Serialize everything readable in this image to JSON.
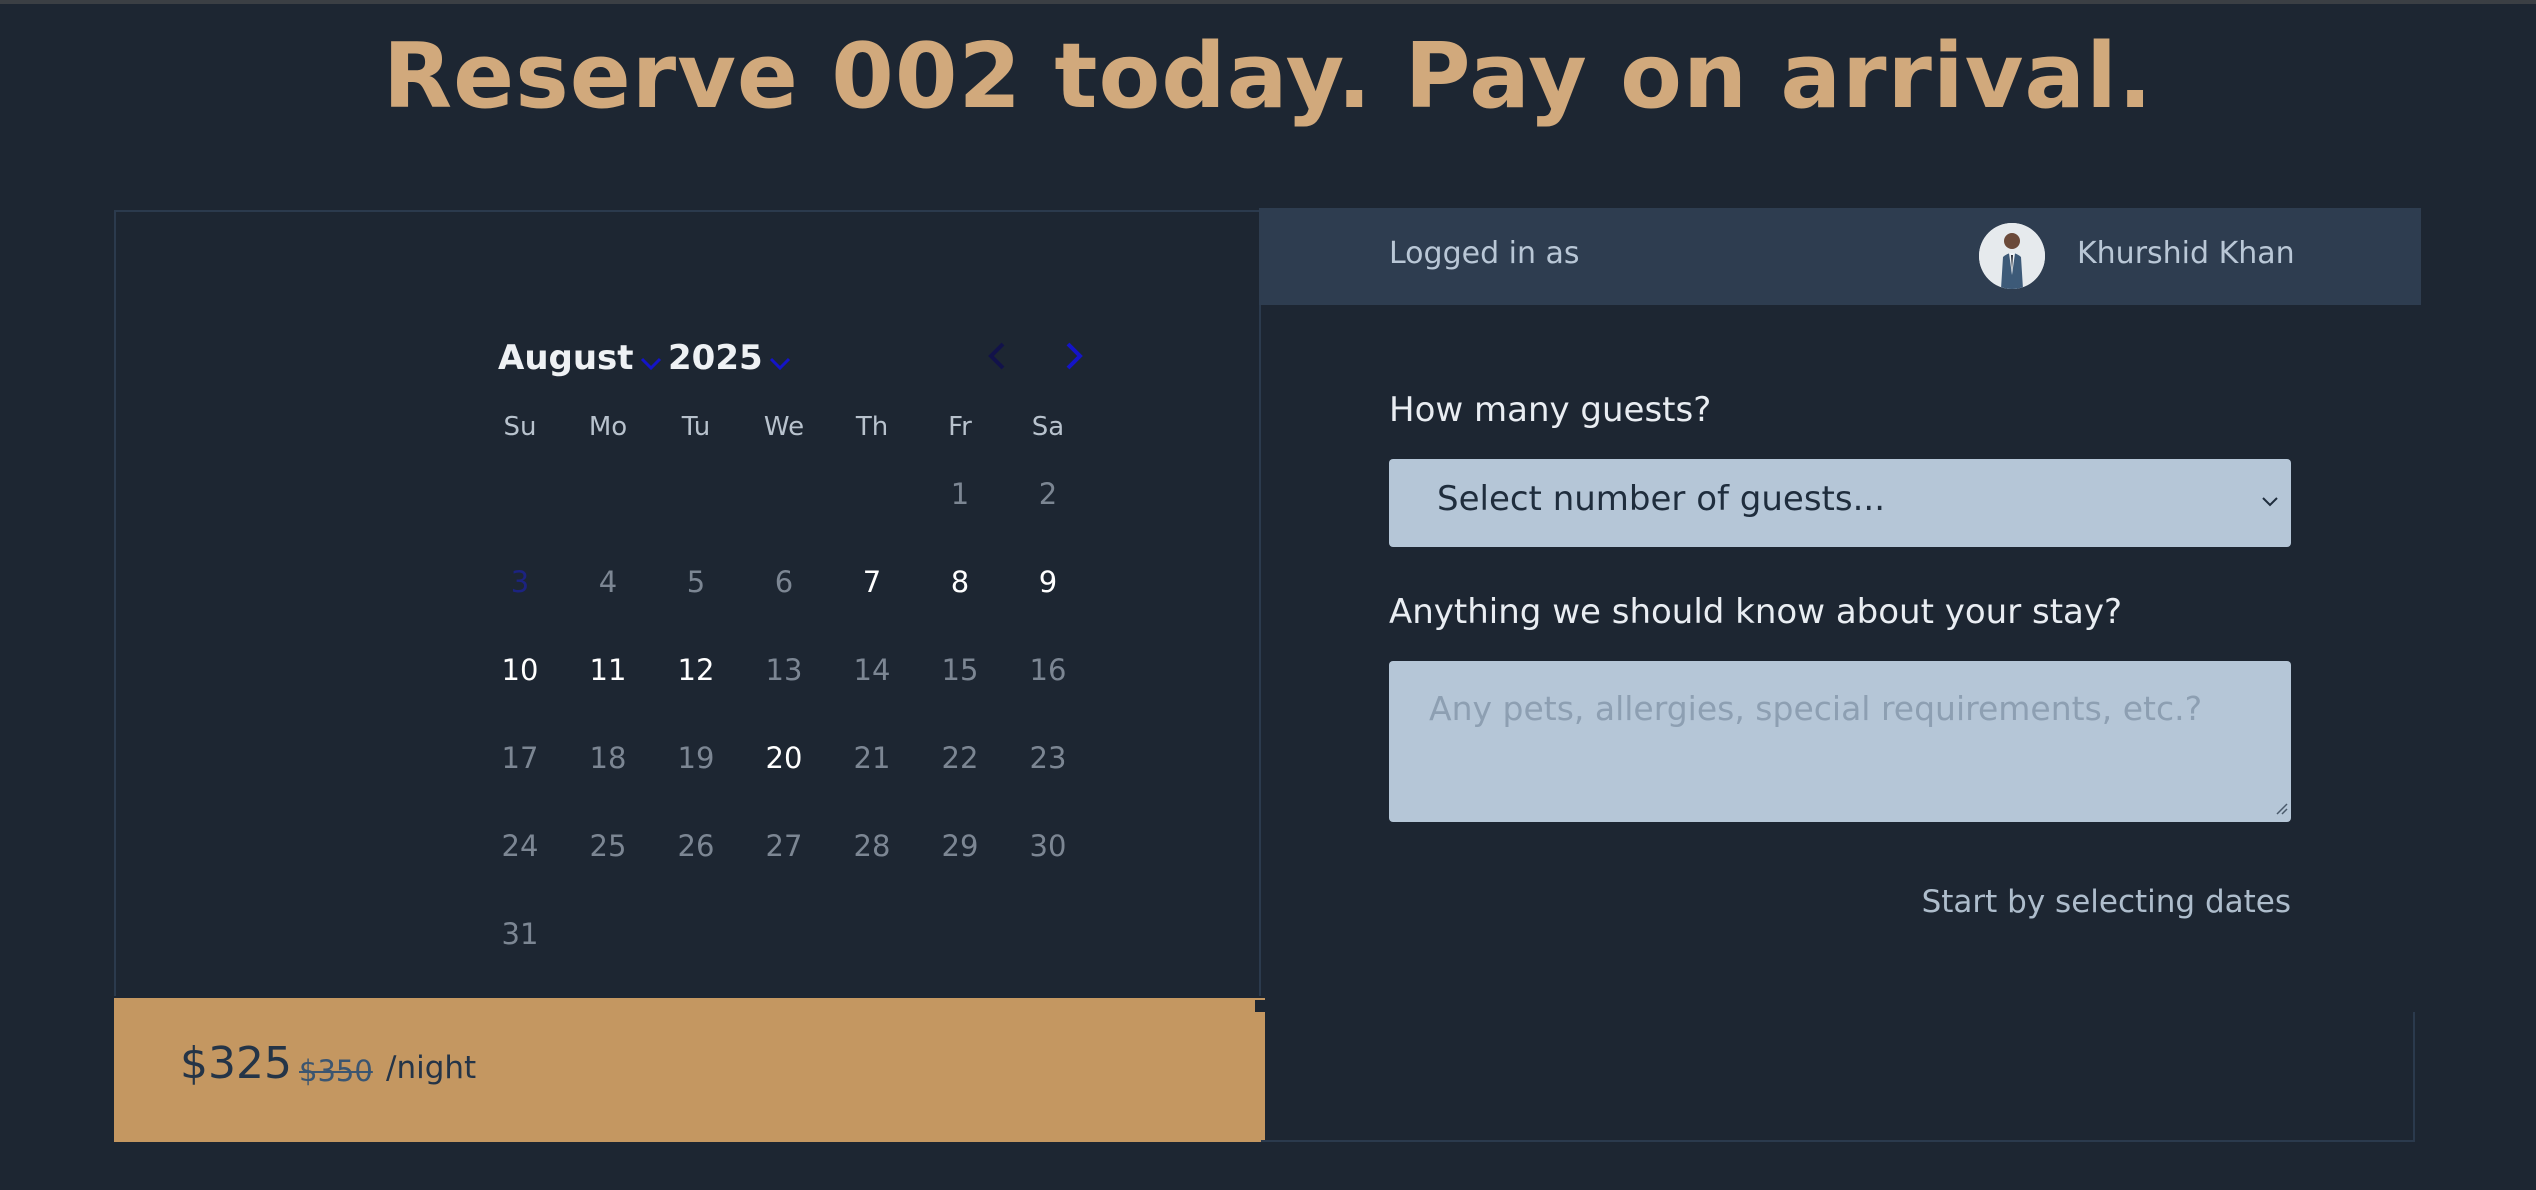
{
  "headline": "Reserve 002 today. Pay on arrival.",
  "calendar": {
    "month": "August",
    "year": "2025",
    "weekdays": [
      "Su",
      "Mo",
      "Tu",
      "We",
      "Th",
      "Fr",
      "Sa"
    ],
    "weeks": [
      [
        {
          "day": "",
          "state": "empty"
        },
        {
          "day": "",
          "state": "empty"
        },
        {
          "day": "",
          "state": "empty"
        },
        {
          "day": "",
          "state": "empty"
        },
        {
          "day": "",
          "state": "empty"
        },
        {
          "day": "1",
          "state": "unavailable"
        },
        {
          "day": "2",
          "state": "unavailable"
        }
      ],
      [
        {
          "day": "3",
          "state": "today"
        },
        {
          "day": "4",
          "state": "unavailable"
        },
        {
          "day": "5",
          "state": "unavailable"
        },
        {
          "day": "6",
          "state": "unavailable"
        },
        {
          "day": "7",
          "state": "available"
        },
        {
          "day": "8",
          "state": "available"
        },
        {
          "day": "9",
          "state": "available"
        }
      ],
      [
        {
          "day": "10",
          "state": "available"
        },
        {
          "day": "11",
          "state": "available"
        },
        {
          "day": "12",
          "state": "available"
        },
        {
          "day": "13",
          "state": "unavailable"
        },
        {
          "day": "14",
          "state": "unavailable"
        },
        {
          "day": "15",
          "state": "unavailable"
        },
        {
          "day": "16",
          "state": "unavailable"
        }
      ],
      [
        {
          "day": "17",
          "state": "unavailable"
        },
        {
          "day": "18",
          "state": "unavailable"
        },
        {
          "day": "19",
          "state": "unavailable"
        },
        {
          "day": "20",
          "state": "available"
        },
        {
          "day": "21",
          "state": "unavailable"
        },
        {
          "day": "22",
          "state": "unavailable"
        },
        {
          "day": "23",
          "state": "unavailable"
        }
      ],
      [
        {
          "day": "24",
          "state": "unavailable"
        },
        {
          "day": "25",
          "state": "unavailable"
        },
        {
          "day": "26",
          "state": "unavailable"
        },
        {
          "day": "27",
          "state": "unavailable"
        },
        {
          "day": "28",
          "state": "unavailable"
        },
        {
          "day": "29",
          "state": "unavailable"
        },
        {
          "day": "30",
          "state": "unavailable"
        }
      ],
      [
        {
          "day": "31",
          "state": "unavailable"
        },
        {
          "day": "",
          "state": "empty"
        },
        {
          "day": "",
          "state": "empty"
        },
        {
          "day": "",
          "state": "empty"
        },
        {
          "day": "",
          "state": "empty"
        },
        {
          "day": "",
          "state": "empty"
        },
        {
          "day": "",
          "state": "empty"
        }
      ]
    ]
  },
  "pricing": {
    "current": "$325",
    "original": "$350",
    "unit": "/night"
  },
  "user": {
    "logged_in_label": "Logged in as",
    "name": "Khurshid Khan"
  },
  "form": {
    "guests_label": "How many guests?",
    "guests_selected": "Select number of guests...",
    "notes_label": "Anything we should know about your stay?",
    "notes_placeholder": "Any pets, allergies, special requirements, etc.?",
    "hint": "Start by selecting dates"
  },
  "colors": {
    "background": "#1d2632",
    "accent_gold": "#d1a97c",
    "price_bar": "#c49761",
    "login_bar": "#2e3d50",
    "field_bg": "#b5c6d7",
    "nav_arrow": "#1414c8"
  },
  "icons": {
    "month_caret": "chevron-down-icon",
    "year_caret": "chevron-down-icon",
    "prev": "chevron-left-icon",
    "next": "chevron-right-icon",
    "select_caret": "chevron-down-icon",
    "avatar": "user-avatar"
  }
}
